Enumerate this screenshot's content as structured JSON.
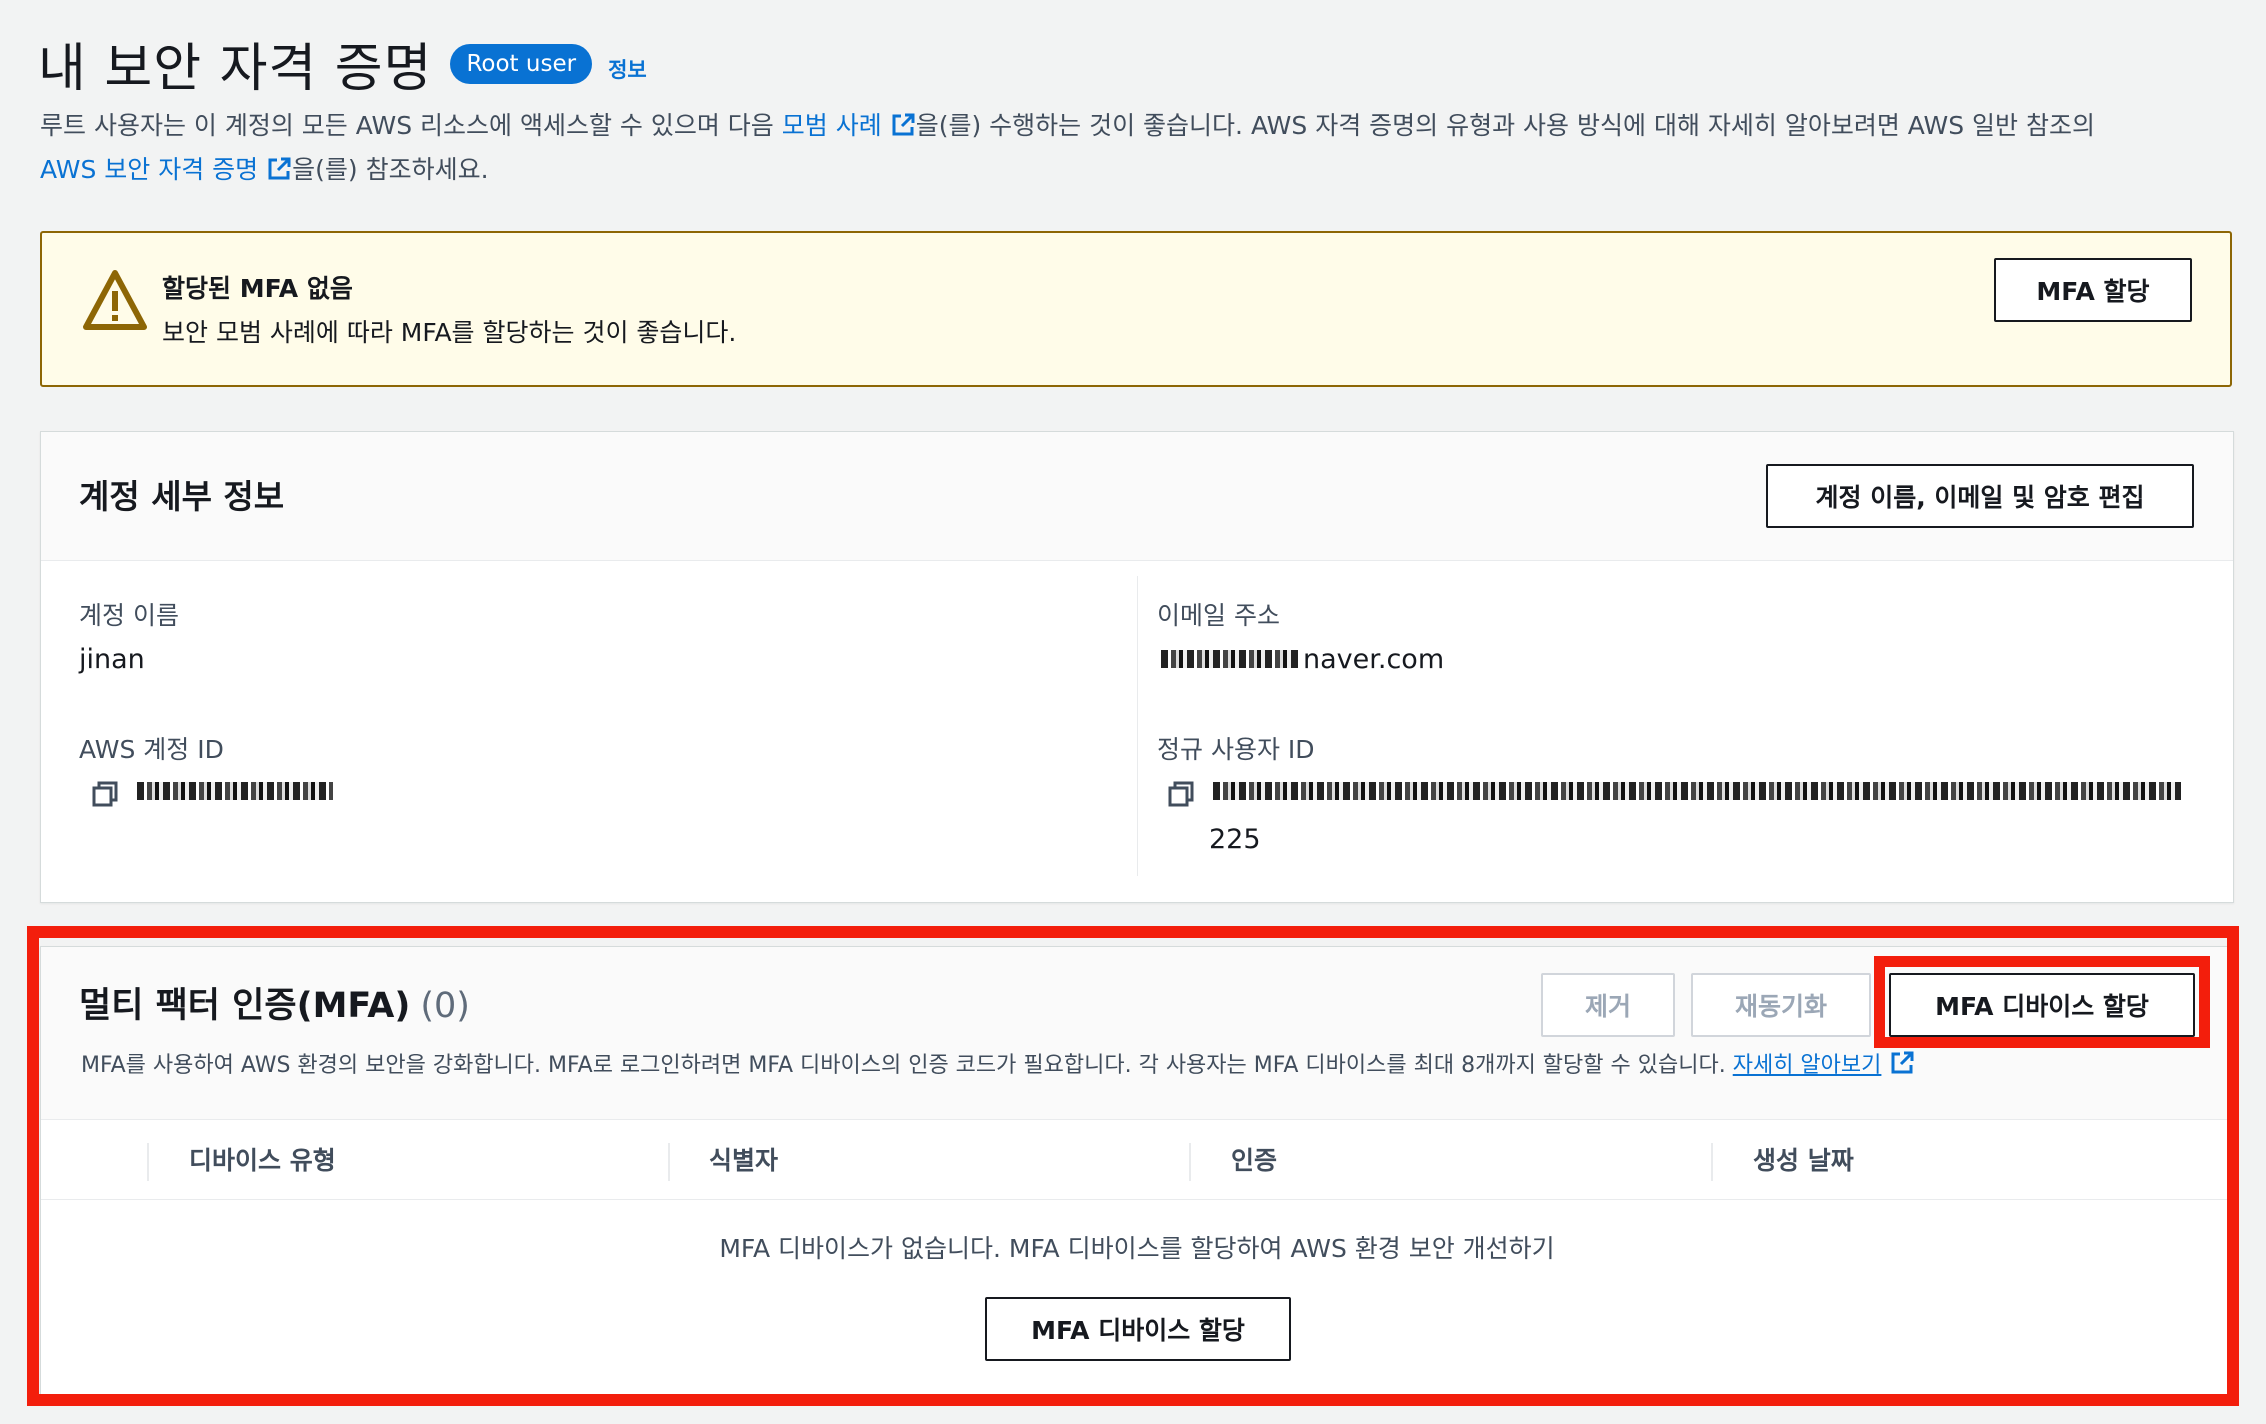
{
  "header": {
    "title": "내 보안 자격 증명",
    "badge": "Root user",
    "info_link": "정보",
    "desc_part1": "루트 사용자는 이 계정의 모든 AWS 리소스에 액세스할 수 있으며 다음 ",
    "desc_link1": "모범 사례",
    "desc_part2": "을(를) 수행하는 것이 좋습니다. AWS 자격 증명의 유형과 사용 방식에 대해 자세히 알아보려면 AWS 일반 참조의",
    "desc_link2": "AWS 보안 자격 증명",
    "desc_part3": "을(를) 참조하세요."
  },
  "alert": {
    "title": "할당된 MFA 없음",
    "text": "보안 모범 사례에 따라 MFA를 할당하는 것이 좋습니다.",
    "button": "MFA 할당",
    "icon": "warning-icon",
    "color": "#8d6605"
  },
  "account": {
    "heading": "계정 세부 정보",
    "edit_button": "계정 이름, 이메일 및 암호 편집",
    "name_label": "계정 이름",
    "name_value": "jinan",
    "email_label": "이메일 주소",
    "email_value": "naver.com",
    "aws_id_label": "AWS 계정 ID",
    "canonical_label": "정규 사용자 ID",
    "canonical_tail": "225"
  },
  "mfa": {
    "heading": "멀티 팩터 인증(MFA)",
    "count": "(0)",
    "remove_button": "제거",
    "resync_button": "재동기화",
    "assign_button": "MFA 디바이스 할당",
    "description": "MFA를 사용하여 AWS 환경의 보안을 강화합니다. MFA로 로그인하려면 MFA 디바이스의 인증 코드가 필요합니다. 각 사용자는 MFA 디바이스를 최대 8개까지 할당할 수 있습니다.",
    "learn_more": "자세히 알아보기",
    "columns": [
      "디바이스 유형",
      "식별자",
      "인증",
      "생성 날짜"
    ],
    "empty_text": "MFA 디바이스가 없습니다. MFA 디바이스를 할당하여 AWS 환경 보안 개선하기",
    "empty_button": "MFA 디바이스 할당"
  },
  "colors": {
    "accent": "#0972d3",
    "highlight": "#f31e0c",
    "alert_bg": "#fffce9"
  }
}
